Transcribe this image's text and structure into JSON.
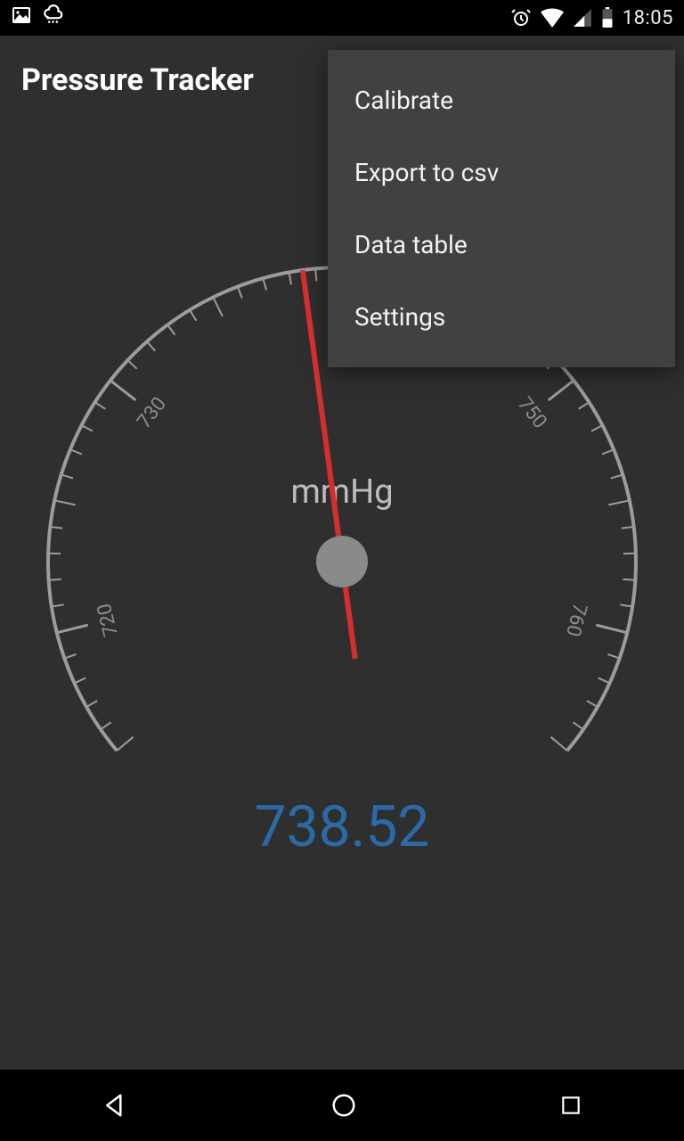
{
  "status_bar": {
    "time": "18:05",
    "icons_left": [
      "image-icon",
      "weather-icon"
    ],
    "icons_right": [
      "alarm-icon",
      "wifi-icon",
      "cell-signal-icon",
      "battery-icon"
    ]
  },
  "app_bar": {
    "title": "Pressure Tracker"
  },
  "menu": {
    "items": [
      {
        "label": "Calibrate"
      },
      {
        "label": "Export to csv"
      },
      {
        "label": "Data table"
      },
      {
        "label": "Settings"
      }
    ]
  },
  "gauge": {
    "unit": "mmHg",
    "value_text": "738.52",
    "value": 738.52,
    "scale_min": 715,
    "scale_max": 765,
    "major_step": 10,
    "labels": [
      "720",
      "730",
      "750",
      "760"
    ],
    "needle_color": "#d32f2f",
    "value_color": "#2b6aa6"
  },
  "nav_bar": {
    "buttons": [
      "back",
      "home",
      "recent"
    ]
  }
}
